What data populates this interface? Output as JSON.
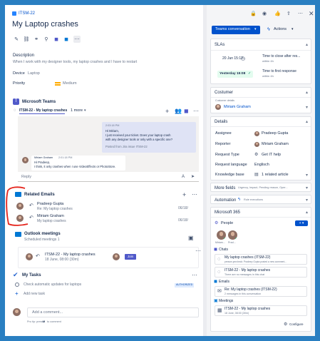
{
  "issue": {
    "key": "ITSM-22",
    "title": "My Laptop crashes"
  },
  "fields": {
    "description_label": "Description",
    "description": "When I work with my designer tools, my laptop crashes and I have to restart",
    "device_label": "Device",
    "device": "Laptop",
    "priority_label": "Priority",
    "priority": "Medium"
  },
  "teams": {
    "heading": "Microsoft Teams",
    "tab": "ITSM-22 - My laptop crashes",
    "more": "1 more",
    "msg1_time": "2:03:18 PM",
    "msg1_lines": [
      "Hi Miriam,",
      "I just received your ticket. Does your laptop crash",
      "with any designer tools or only with a specific one?"
    ],
    "msg1_posted": "Posted from Jira issue ITSM-22",
    "msg2_author": "Miriam Graham",
    "msg2_time": "2:01:18 PM",
    "msg2_lines": [
      "Hi Pradeep,",
      "I think, it only crashes when I use VideoEffects or PhotoStore."
    ],
    "reply_placeholder": "Reply"
  },
  "related_emails": {
    "heading": "Related Emails",
    "items": [
      {
        "from": "Pradeep Gupta",
        "subject": "Re: My laptop crashes",
        "date": "06/18/"
      },
      {
        "from": "Miriam Graham",
        "subject": "My laptop crashes",
        "date": "06/18/"
      }
    ]
  },
  "meetings": {
    "heading": "Outlook meetings",
    "sub": "Scheduled meetings 1",
    "title": "ITSM-22 - My laptop crashes",
    "when": "18 June, 08:00 (30m)",
    "join": "Join"
  },
  "tasks": {
    "heading": "My Tasks",
    "item": "Check automatic updates for laptops",
    "badge": "AUTHORIZED",
    "add": "Add new task"
  },
  "comment": {
    "placeholder": "Add a comment...",
    "tip_pre": "Pro tip: press",
    "tip_key": "M",
    "tip_post": "to comment"
  },
  "topbar": {
    "teams_btn": "Teams conversation",
    "actions": "Actions"
  },
  "slas": {
    "heading": "SLAs",
    "sla1_date": "20 Jun 15:12",
    "sla1_title": "Time to close after res...",
    "sla1_sub": "within 4h",
    "sla2_date": "Yesterday 15:08",
    "sla2_title": "Time to first response",
    "sla2_sub": "within 4h"
  },
  "costumer": {
    "heading": "Costumer",
    "label": "Customer details",
    "name": "Miriam Graham"
  },
  "details": {
    "heading": "Details",
    "rows": [
      {
        "label": "Assignee",
        "value": "Pradeep Gupta"
      },
      {
        "label": "Reporter",
        "value": "Miriam Graham"
      },
      {
        "label": "Request Type",
        "value": "Get IT help"
      },
      {
        "label": "Request language",
        "value": "Englisch"
      },
      {
        "label": "Knowledge base",
        "value": "1 related article"
      }
    ]
  },
  "more_fields": {
    "label": "More fields",
    "value": "Urgency, Impact, Pending reason, Oper..."
  },
  "automation": {
    "label": "Automation",
    "value": "Rule executions"
  },
  "m365": {
    "heading": "Microsoft 365",
    "people": "People",
    "people_names": [
      "Miriam...",
      "Prad..."
    ],
    "chats": "Chats",
    "chat1_title": "My laptop crashes (ITSM-22)",
    "chat1_sub": "pressm.pnrcheck: Pradeep Gupta posted a new comment...",
    "chat2_title": "ITSM-22 - My laptop crashes",
    "chat2_sub": "There are no messages in this chat",
    "emails": "Emails",
    "email1_title": "Re: My laptop crashes (ITSM-22)",
    "email1_sub": "2 messages in this conversation",
    "meetings": "Meetings",
    "meeting1_title": "ITSM-22 - My laptop crashes",
    "meeting1_sub": "18 June, 08:00 (30m)",
    "configure": "Configure"
  }
}
